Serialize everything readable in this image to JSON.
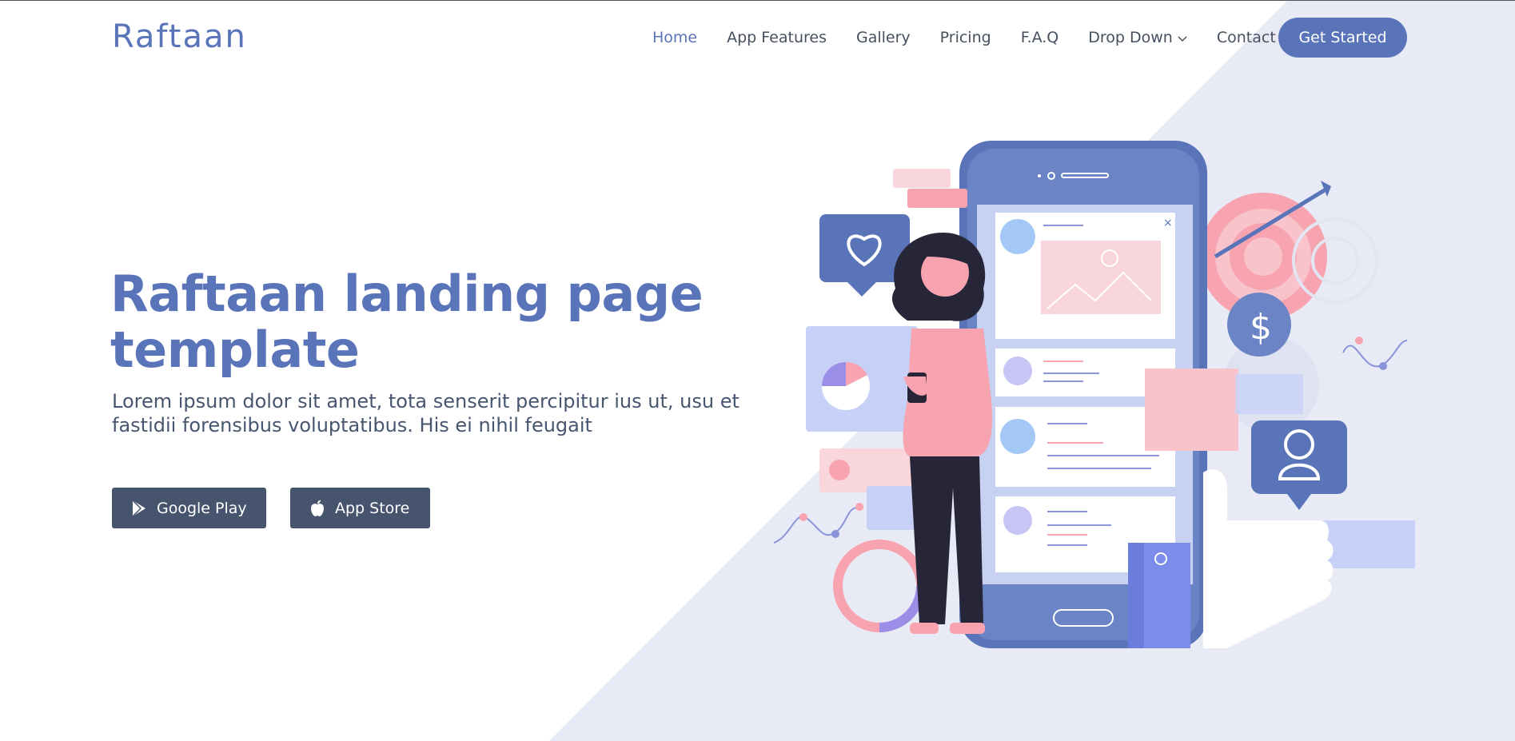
{
  "header": {
    "logo": "Raftaan",
    "nav": [
      {
        "label": "Home",
        "active": true
      },
      {
        "label": "App Features",
        "active": false
      },
      {
        "label": "Gallery",
        "active": false
      },
      {
        "label": "Pricing",
        "active": false
      },
      {
        "label": "F.A.Q",
        "active": false
      },
      {
        "label": "Drop Down",
        "active": false,
        "has_dropdown": true
      },
      {
        "label": "Contact",
        "active": false
      }
    ],
    "cta": "Get Started"
  },
  "hero": {
    "title_line1": "Raftaan landing page",
    "title_line2": "template",
    "text_line1": "Lorem ipsum dolor sit amet, tota senserit percipitur ius ut, usu et",
    "text_line2": "fastidii forensibus voluptatibus. His ei nihil feugait",
    "google_play": "Google Play",
    "app_store": "App Store"
  },
  "colors": {
    "brand": "#5a74b9",
    "button_dark": "#47546d",
    "diagonal_bg": "#e8ebf5",
    "accent_pink": "#f7a4b0"
  },
  "icons": [
    "chevron-down-icon",
    "google-play-icon",
    "apple-icon"
  ]
}
